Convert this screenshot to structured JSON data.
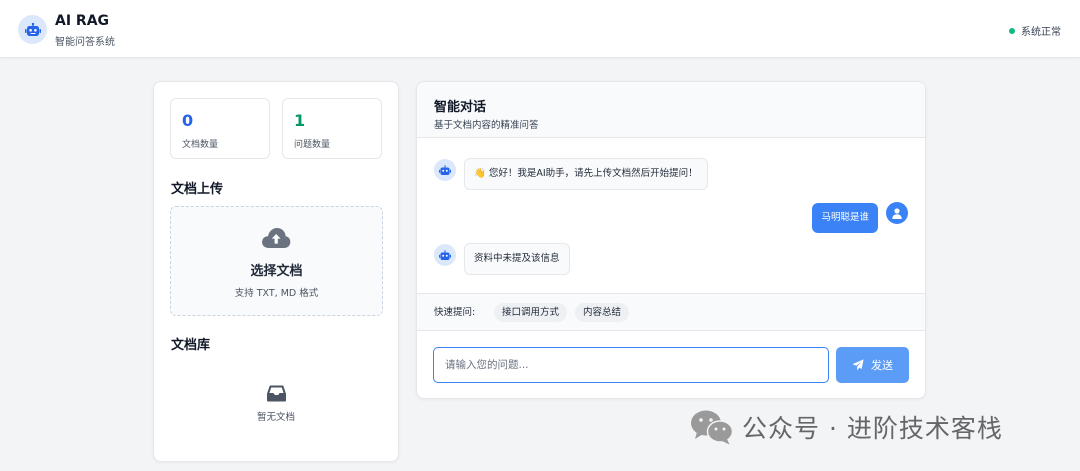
{
  "header": {
    "title": "AI RAG",
    "subtitle": "智能问答系统",
    "status": "系统正常",
    "logo_icon": "robot-icon",
    "status_color": "#10b981"
  },
  "stats": [
    {
      "value": "0",
      "label": "文档数量",
      "color": "#2563eb"
    },
    {
      "value": "1",
      "label": "问题数量",
      "color": "#059669"
    }
  ],
  "upload": {
    "section_title": "文档上传",
    "title": "选择文档",
    "hint": "支持 TXT, MD 格式",
    "icon": "cloud-upload-icon"
  },
  "library": {
    "section_title": "文档库",
    "empty_text": "暂无文档",
    "empty_icon": "inbox-icon"
  },
  "chat": {
    "title": "智能对话",
    "subtitle": "基于文档内容的精准问答",
    "messages": [
      {
        "role": "bot",
        "text": "👋 您好！我是AI助手，请先上传文档然后开始提问！"
      },
      {
        "role": "user",
        "text": "马明聪是谁"
      },
      {
        "role": "bot",
        "text": "资料中未提及该信息"
      }
    ],
    "quick_label": "快速提问:",
    "quick_chips": [
      "接口调用方式",
      "内容总结"
    ],
    "input_placeholder": "请输入您的问题...",
    "send_label": "发送",
    "accent": "#3b82f6"
  },
  "watermark": {
    "text": "公众号 · 进阶技术客栈",
    "icon": "wechat-icon"
  }
}
